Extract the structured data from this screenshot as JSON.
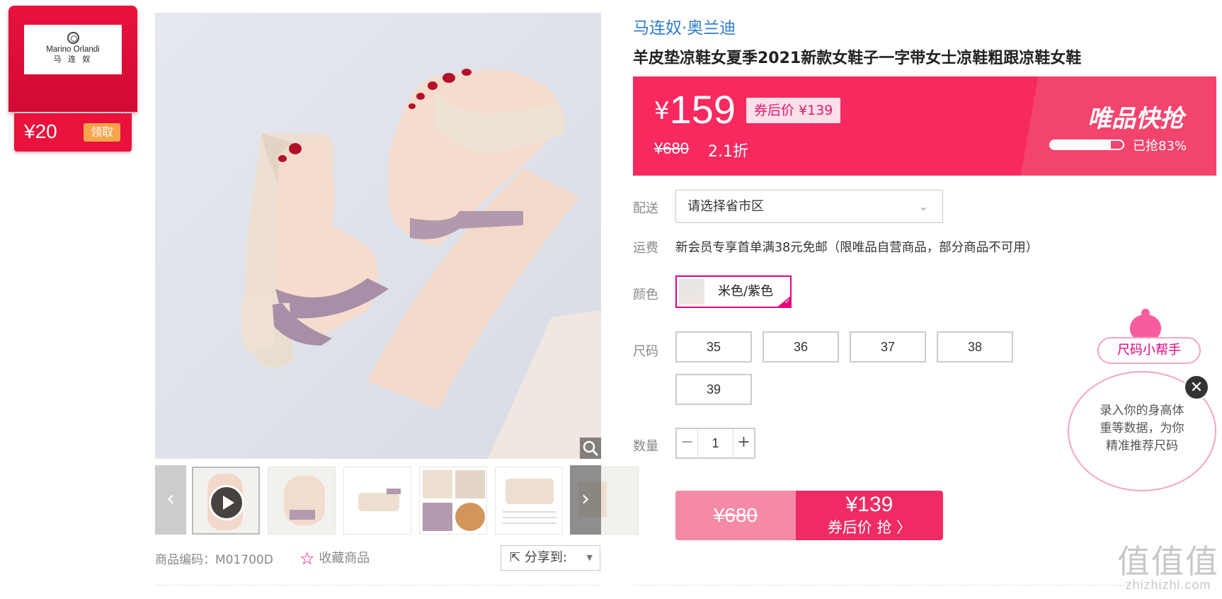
{
  "brand_card": {
    "logo_text_en": "Marino Orlandi",
    "logo_text_cn": "马 连 奴",
    "coupon_amount": "¥20",
    "claim_label": "领取"
  },
  "gallery": {
    "prev_icon": "chevron-left-icon",
    "next_icon": "chevron-right-icon",
    "zoom_icon": "magnifier-icon"
  },
  "product": {
    "brand": "马连奴·奥兰迪",
    "title": "羊皮垫凉鞋女夏季2021新款女鞋子一字带女士凉鞋粗跟凉鞋女鞋",
    "sku_label": "商品编码：",
    "sku": "M01700D",
    "favorite_label": "收藏商品",
    "share_label": "分享到:"
  },
  "pricing": {
    "currency": "¥",
    "price": "159",
    "coupon_price_label": "券后价 ¥139",
    "original_price": "¥680",
    "discount": "2.1折",
    "flash_title": "唯品快抢",
    "sold_percent": 83,
    "sold_label": "已抢83%"
  },
  "options": {
    "delivery_label": "配送",
    "region_placeholder": "请选择省市区",
    "shipping_label": "运费",
    "shipping_text": "新会员专享首单满38元免邮（限唯品自营商品，部分商品不可用）",
    "color_label": "颜色",
    "color_value": "米色/紫色",
    "size_label": "尺码",
    "sizes": [
      "35",
      "36",
      "37",
      "38",
      "39"
    ],
    "quantity_label": "数量",
    "quantity": "1",
    "minus": "−",
    "plus": "+"
  },
  "buy": {
    "original_price": "¥680",
    "coupon_price": "¥139",
    "cta_label": "券后价 抢 〉"
  },
  "size_helper": {
    "tag": "尺码小帮手",
    "line1": "录入你的身高体",
    "line2": "重等数据，为你",
    "line3": "精准推荐尺码",
    "close": "✕"
  },
  "watermark": {
    "big": "值值值",
    "small": "zhizhizhi.com"
  },
  "colors": {
    "accent": "#f7295f",
    "brand_red": "#e8123d",
    "link_blue": "#2f7ccf",
    "select_pink": "#e4007f"
  }
}
